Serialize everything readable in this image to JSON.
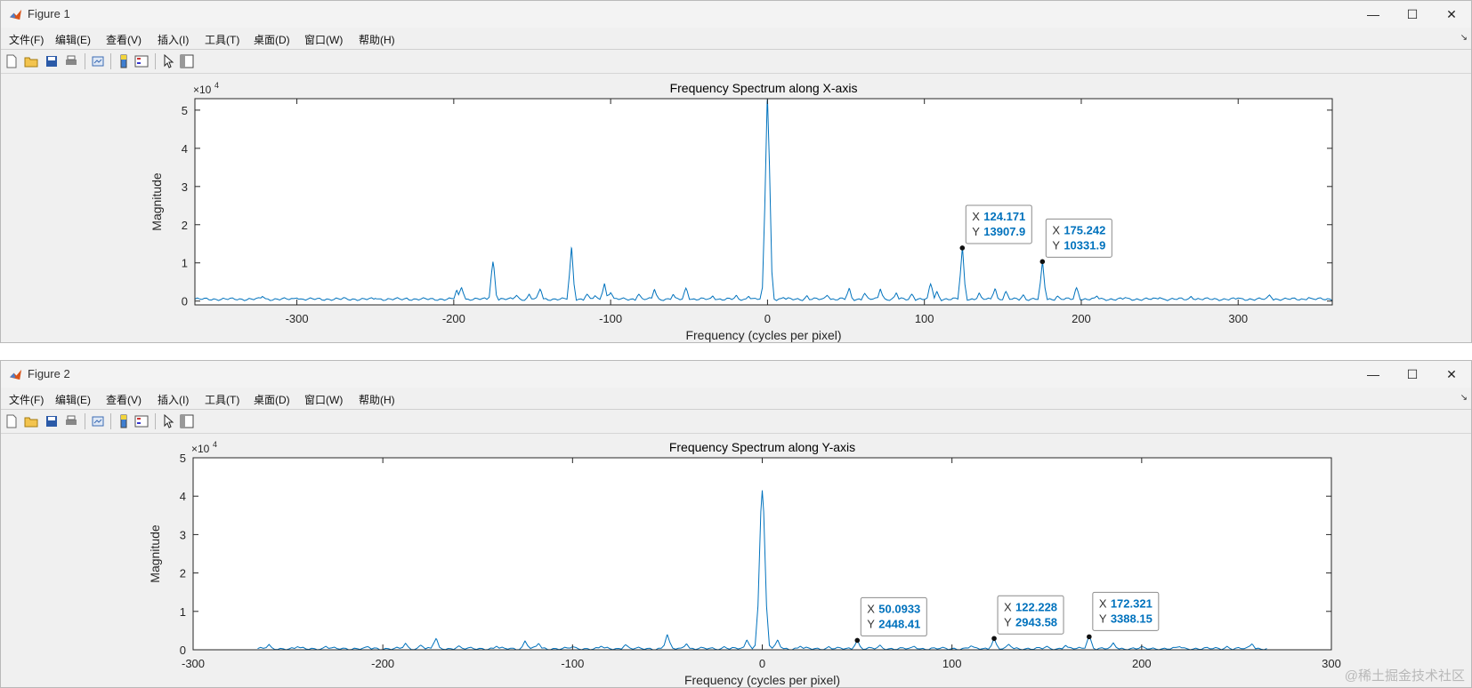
{
  "menu": [
    "文件(F)",
    "编辑(E)",
    "查看(V)",
    "插入(I)",
    "工具(T)",
    "桌面(D)",
    "窗口(W)",
    "帮助(H)"
  ],
  "window_controls": {
    "minimize": "—",
    "maximize": "☐",
    "close": "✕"
  },
  "toolbar_icons": [
    "new-figure-icon",
    "open-file-icon",
    "save-icon",
    "print-icon",
    "link-plot-icon",
    "insert-colorbar-icon",
    "insert-legend-icon",
    "edit-plot-arrow-icon",
    "property-inspector-icon"
  ],
  "colors": {
    "line": "#0072bd",
    "datatip_value": "#0072bd",
    "axes_bg": "#ffffff",
    "figure_bg": "#f0f0f0"
  },
  "figure1": {
    "window_title": "Figure 1",
    "chart_data": {
      "type": "line",
      "title": "Frequency Spectrum along X-axis",
      "xlabel": "Frequency (cycles per pixel)",
      "ylabel": "Magnitude",
      "y_exponent_label": "×10",
      "y_exponent": "4",
      "xlim": [
        -365,
        360
      ],
      "ylim": [
        -1000,
        53000
      ],
      "xticks": [
        -300,
        -200,
        -100,
        0,
        100,
        200,
        300
      ],
      "xticklabels": [
        "-300",
        "-200",
        "-100",
        "0",
        "100",
        "200",
        "300"
      ],
      "yticks": [
        0,
        10000,
        20000,
        30000,
        40000,
        50000
      ],
      "yticklabels": [
        "0",
        "1",
        "2",
        "3",
        "4",
        "5"
      ],
      "grid": false,
      "baseline": 500,
      "x_range": [
        -365,
        360
      ],
      "peaks": [
        [
          -322,
          1200
        ],
        [
          -300,
          800
        ],
        [
          -270,
          900
        ],
        [
          -250,
          700
        ],
        [
          -230,
          800
        ],
        [
          -198,
          2800
        ],
        [
          -195,
          3500
        ],
        [
          -175,
          10300
        ],
        [
          -160,
          1500
        ],
        [
          -152,
          1800
        ],
        [
          -145,
          3100
        ],
        [
          -125,
          13907.9
        ],
        [
          -115,
          1800
        ],
        [
          -110,
          1400
        ],
        [
          -104,
          4500
        ],
        [
          -100,
          2200
        ],
        [
          -82,
          1800
        ],
        [
          -72,
          3000
        ],
        [
          -60,
          1700
        ],
        [
          -52,
          3400
        ],
        [
          -35,
          1300
        ],
        [
          -20,
          1500
        ],
        [
          -12,
          1200
        ],
        [
          0,
          53000
        ],
        [
          10,
          900
        ],
        [
          25,
          1400
        ],
        [
          38,
          1500
        ],
        [
          52,
          3300
        ],
        [
          62,
          2000
        ],
        [
          72,
          3100
        ],
        [
          82,
          2100
        ],
        [
          92,
          1800
        ],
        [
          104,
          4500
        ],
        [
          108,
          2500
        ],
        [
          124.171,
          13907.9
        ],
        [
          135,
          2100
        ],
        [
          145,
          3200
        ],
        [
          152,
          2500
        ],
        [
          163,
          1600
        ],
        [
          175.242,
          10331.9
        ],
        [
          185,
          1300
        ],
        [
          197,
          3500
        ],
        [
          210,
          1300
        ],
        [
          228,
          900
        ],
        [
          250,
          900
        ],
        [
          270,
          1200
        ],
        [
          300,
          800
        ],
        [
          320,
          1600
        ],
        [
          345,
          900
        ]
      ],
      "datatips": [
        {
          "x": "124.171",
          "y": "13907.9",
          "xv": 124.171,
          "yv": 13907.9
        },
        {
          "x": "175.242",
          "y": "10331.9",
          "xv": 175.242,
          "yv": 10331.9
        }
      ]
    }
  },
  "figure2": {
    "window_title": "Figure 2",
    "chart_data": {
      "type": "line",
      "title": "Frequency Spectrum along Y-axis",
      "xlabel": "Frequency (cycles per pixel)",
      "ylabel": "Magnitude",
      "y_exponent_label": "×10",
      "y_exponent": "4",
      "xlim": [
        -300,
        300
      ],
      "ylim": [
        0,
        50000
      ],
      "xticks": [
        -300,
        -200,
        -100,
        0,
        100,
        200,
        300
      ],
      "xticklabels": [
        "-300",
        "-200",
        "-100",
        "0",
        "100",
        "200",
        "300"
      ],
      "yticks": [
        0,
        10000,
        20000,
        30000,
        40000,
        50000
      ],
      "yticklabels": [
        "0",
        "1",
        "2",
        "3",
        "4",
        "5"
      ],
      "grid": false,
      "baseline": 300,
      "x_range": [
        -266,
        266
      ],
      "peaks": [
        [
          -260,
          1400
        ],
        [
          -245,
          800
        ],
        [
          -230,
          900
        ],
        [
          -208,
          800
        ],
        [
          -188,
          1700
        ],
        [
          -180,
          1200
        ],
        [
          -172,
          2900
        ],
        [
          -160,
          1000
        ],
        [
          -140,
          900
        ],
        [
          -125,
          2300
        ],
        [
          -118,
          1600
        ],
        [
          -100,
          800
        ],
        [
          -85,
          900
        ],
        [
          -72,
          1300
        ],
        [
          -50,
          3900
        ],
        [
          -40,
          1500
        ],
        [
          -20,
          800
        ],
        [
          0,
          41500
        ],
        [
          8,
          2500
        ],
        [
          -8,
          2500
        ],
        [
          20,
          900
        ],
        [
          35,
          800
        ],
        [
          50.0933,
          2448.41
        ],
        [
          62,
          1200
        ],
        [
          80,
          900
        ],
        [
          110,
          1000
        ],
        [
          122.228,
          2943.58
        ],
        [
          130,
          1400
        ],
        [
          150,
          900
        ],
        [
          160,
          1100
        ],
        [
          172.321,
          3388.15
        ],
        [
          185,
          1800
        ],
        [
          200,
          900
        ],
        [
          220,
          800
        ],
        [
          245,
          900
        ],
        [
          258,
          1500
        ]
      ],
      "datatips": [
        {
          "x": "50.0933",
          "y": "2448.41",
          "xv": 50.0933,
          "yv": 2448.41
        },
        {
          "x": "122.228",
          "y": "2943.58",
          "xv": 122.228,
          "yv": 2943.58
        },
        {
          "x": "172.321",
          "y": "3388.15",
          "xv": 172.321,
          "yv": 3388.15
        }
      ]
    }
  },
  "datatip_x_prefix": "X",
  "datatip_y_prefix": "Y",
  "watermark": "@稀土掘金技术社区"
}
